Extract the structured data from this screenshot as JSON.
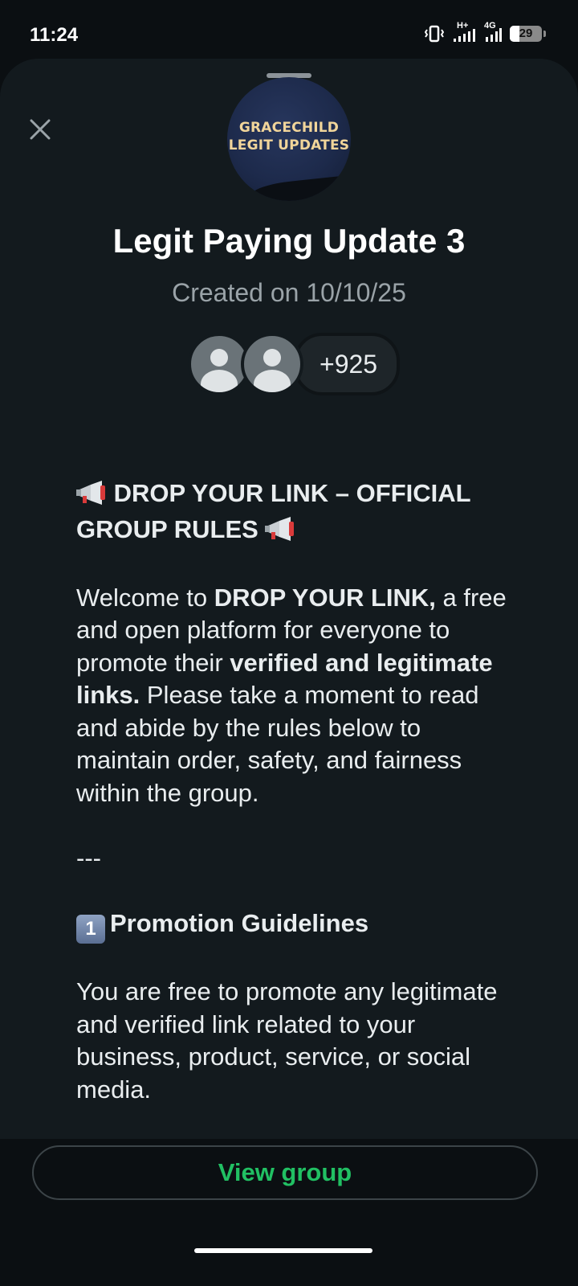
{
  "status_bar": {
    "time": "11:24",
    "network_label_1": "H+",
    "network_label_2": "4G",
    "battery_level": "29",
    "battery_fraction": 0.29
  },
  "sheet": {
    "close_icon": "close-icon",
    "group": {
      "avatar_text_line1": "GRACECHILD",
      "avatar_text_line2": "LEGIT UPDATES",
      "title": "Legit Paying Update 3",
      "created": "Created on 10/10/25",
      "members_more": "+925"
    },
    "description": {
      "heading": "DROP YOUR LINK – OFFICIAL GROUP RULES",
      "intro_1": "Welcome to ",
      "intro_bold_1": "DROP YOUR LINK,",
      "intro_2": " a free and open platform for everyone to promote their ",
      "intro_bold_2": "verified and legitimate links.",
      "intro_3": " Please take a moment to read and abide by the rules below to maintain order, safety, and fairness within the group.",
      "divider": "---",
      "section_number": "1",
      "section_heading": "Promotion Guidelines",
      "section_text": "You are free to promote any legitimate and verified link related to your business, product, service, or social media."
    }
  },
  "footer": {
    "view_group_label": "View group",
    "accent_color": "#21c063"
  }
}
